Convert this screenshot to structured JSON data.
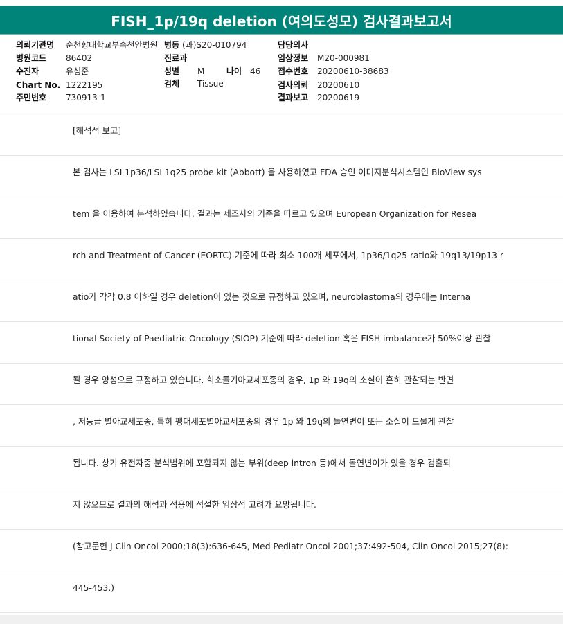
{
  "title": "FISH_1p/19q deletion (여의도성모) 검사결과보고서",
  "header": {
    "institution_label": "의뢰기관명",
    "institution_value": "순천향대학교부속천안병원",
    "ward_label": "병동",
    "ward_value": "(과)S20-010794",
    "doctor_label": "담당의사",
    "doctor_value": "",
    "hospital_code_label": "병원코드",
    "hospital_code_value": "86402",
    "dept_label": "진료과",
    "dept_value": "",
    "clinical_info_label": "임상정보",
    "clinical_info_value": "M20-000981",
    "patient_label": "수진자",
    "patient_value": "유성준",
    "sex_label": "성별",
    "sex_value": "M",
    "age_label": "나이",
    "age_value": "46",
    "receipt_no_label": "접수번호",
    "receipt_no_value": "20200610-38683",
    "chart_no_label": "Chart No.",
    "chart_no_value": "1222195",
    "specimen_label": "검체",
    "specimen_value": "Tissue",
    "request_label": "검사의뢰",
    "request_value": "20200610",
    "rrn_label": "주민번호",
    "rrn_value": "730913-1",
    "report_label": "결과보고",
    "report_value": "20200619"
  },
  "lines": [
    "[해석적 보고]",
    "본 검사는 LSI 1p36/LSI 1q25 probe kit (Abbott) 을 사용하였고 FDA 승인 이미지분석시스템인 BioView sys",
    "tem 을 이용하여 분석하였습니다. 결과는 제조사의 기준을 따르고 있으며 European Organization for Resea",
    "rch and Treatment of Cancer (EORTC) 기준에 따라 최소 100개 세포에서, 1p36/1q25 ratio와 19q13/19p13 r",
    "atio가 각각 0.8 이하일 경우 deletion이 있는 것으로 규정하고 있으며, neuroblastoma의 경우에는 Interna",
    "tional Society of Paediatric Oncology (SIOP) 기준에 따라 deletion 혹은 FISH imbalance가 50%이상 관찰",
    "될 경우 양성으로 규정하고 있습니다. 희소돌기아교세포종의 경우, 1p 와 19q의 소실이 흔히 관찰되는 반면",
    ", 저등급 별아교세포종, 특히 팽대세포별아교세포종의 경우 1p 와 19q의 돌연변이 또는 소실이 드물게 관찰",
    "됩니다. 상기 유전자중 분석범위에 포함되지 않는 부위(deep intron 등)에서 돌연변이가 있을 경우 검출되",
    "지 않으므로 결과의 해석과 적용에 적절한 임상적 고려가 요망됩니다.",
    "(참고문헌 J Clin Oncol 2000;18(3):636-645, Med Pediatr Oncol 2001;37:492-504, Clin Oncol 2015;27(8):",
    "445-453.)"
  ]
}
